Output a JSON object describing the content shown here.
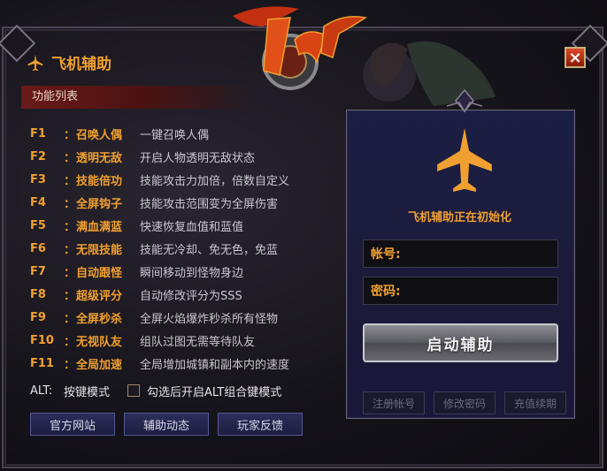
{
  "window": {
    "title": "飞机辅助",
    "close_label": "×"
  },
  "functions": {
    "header": "功能列表",
    "items": [
      {
        "key": "F1",
        "colon": "：",
        "name": "召唤人偶",
        "desc": "一键召唤人偶"
      },
      {
        "key": "F2",
        "colon": "：",
        "name": "透明无敌",
        "desc": "开启人物透明无敌状态"
      },
      {
        "key": "F3",
        "colon": "：",
        "name": "技能倍功",
        "desc": "技能攻击力加倍，倍数自定义"
      },
      {
        "key": "F4",
        "colon": "：",
        "name": "全屏钩子",
        "desc": "技能攻击范围变为全屏伤害"
      },
      {
        "key": "F5",
        "colon": "：",
        "name": "满血满蓝",
        "desc": "快速恢复血值和蓝值"
      },
      {
        "key": "F6",
        "colon": "：",
        "name": "无限技能",
        "desc": "技能无冷却、免无色，免蓝"
      },
      {
        "key": "F7",
        "colon": "：",
        "name": "自动跟怪",
        "desc": "瞬间移动到怪物身边"
      },
      {
        "key": "F8",
        "colon": "：",
        "name": "超级评分",
        "desc": "自动修改评分为SSS"
      },
      {
        "key": "F9",
        "colon": "：",
        "name": "全屏秒杀",
        "desc": "全屏火焰爆炸秒杀所有怪物"
      },
      {
        "key": "F10",
        "colon": "：",
        "name": "无视队友",
        "desc": "组队过图无需等待队友"
      },
      {
        "key": "F11",
        "colon": "：",
        "name": "全局加速",
        "desc": "全局增加城镇和副本内的速度"
      }
    ],
    "alt": {
      "key": "ALT:",
      "mode": "按键模式",
      "desc": "勾选后开启ALT组合键模式"
    }
  },
  "links": {
    "website": "官方网站",
    "news": "辅助动态",
    "feedback": "玩家反馈"
  },
  "login": {
    "status": "飞机辅助正在初始化",
    "account_label": "帐号:",
    "password_label": "密码:",
    "start_button": "启动辅助",
    "register": "注册帐号",
    "change_password": "修改密码",
    "recharge": "充值续期"
  },
  "colors": {
    "accent": "#f0a030",
    "panel": "#1c1a3a",
    "close": "#e04a2a"
  },
  "icons": [
    "plane-icon",
    "close-icon",
    "dnf-logo"
  ]
}
